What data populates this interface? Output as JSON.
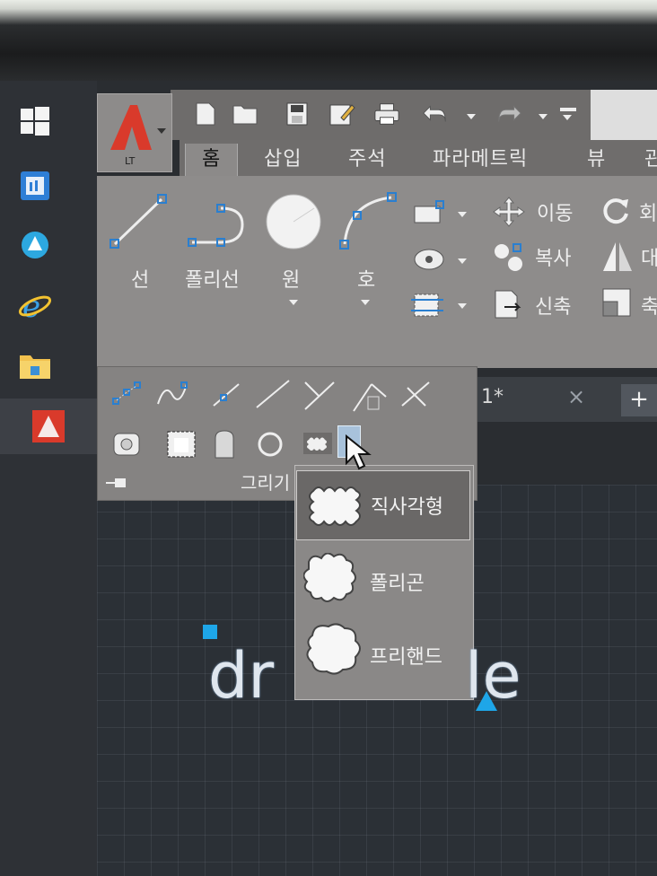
{
  "app": {
    "logo_sub": "LT"
  },
  "ribbon_tabs": [
    "홈",
    "삽입",
    "주석",
    "파라메트릭",
    "뷰",
    "관"
  ],
  "draw_tools": {
    "line": "선",
    "polyline": "폴리선",
    "circle": "원",
    "arc": "호"
  },
  "modify_tools": {
    "move": "이동",
    "copy": "복사",
    "stretch": "신축",
    "rotate": "회",
    "mirror": "대",
    "scale": "축"
  },
  "panel": {
    "title": "그리기"
  },
  "document": {
    "tab_label": "1*",
    "close": "×",
    "new": "+"
  },
  "revcloud_menu": {
    "items": [
      {
        "label": "직사각형",
        "icon": "rectangular-revcloud-icon"
      },
      {
        "label": "폴리곤",
        "icon": "polygonal-revcloud-icon"
      },
      {
        "label": "프리핸드",
        "icon": "freehand-revcloud-icon"
      }
    ]
  },
  "drawing": {
    "text_left": "dr",
    "text_right": "le"
  },
  "colors": {
    "grip": "#1ea6e8",
    "logo": "#d93a2b",
    "highlight": "#a8c2db"
  }
}
